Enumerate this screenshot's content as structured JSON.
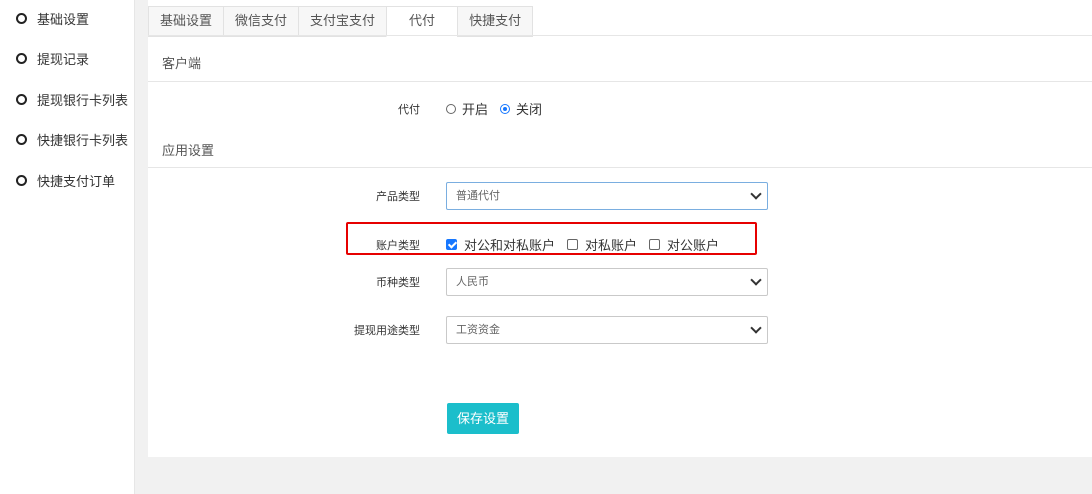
{
  "sidebar": {
    "items": [
      {
        "label": "基础设置"
      },
      {
        "label": "提现记录"
      },
      {
        "label": "提现银行卡列表"
      },
      {
        "label": "快捷银行卡列表"
      },
      {
        "label": "快捷支付订单"
      }
    ]
  },
  "tabs": [
    {
      "label": "基础设置"
    },
    {
      "label": "微信支付"
    },
    {
      "label": "支付宝支付"
    },
    {
      "label": "代付",
      "active": true
    },
    {
      "label": "快捷支付"
    }
  ],
  "client_section": {
    "title": "客户端",
    "daifu": {
      "label": "代付",
      "options": [
        {
          "label": "开启",
          "checked": false
        },
        {
          "label": "关闭",
          "checked": true
        }
      ]
    }
  },
  "app_section": {
    "title": "应用设置",
    "product_type": {
      "label": "产品类型",
      "value": "普通代付"
    },
    "account_type": {
      "label": "账户类型",
      "options": [
        {
          "label": "对公和对私账户",
          "checked": true
        },
        {
          "label": "对私账户",
          "checked": false
        },
        {
          "label": "对公账户",
          "checked": false
        }
      ]
    },
    "currency_type": {
      "label": "币种类型",
      "value": "人民币"
    },
    "withdraw_purpose": {
      "label": "提现用途类型",
      "value": "工资资金"
    }
  },
  "save_button": {
    "label": "保存设置"
  },
  "colors": {
    "accent": "#1bbecb",
    "highlight_border": "#e60000",
    "radio_checked": "#1677ff"
  }
}
